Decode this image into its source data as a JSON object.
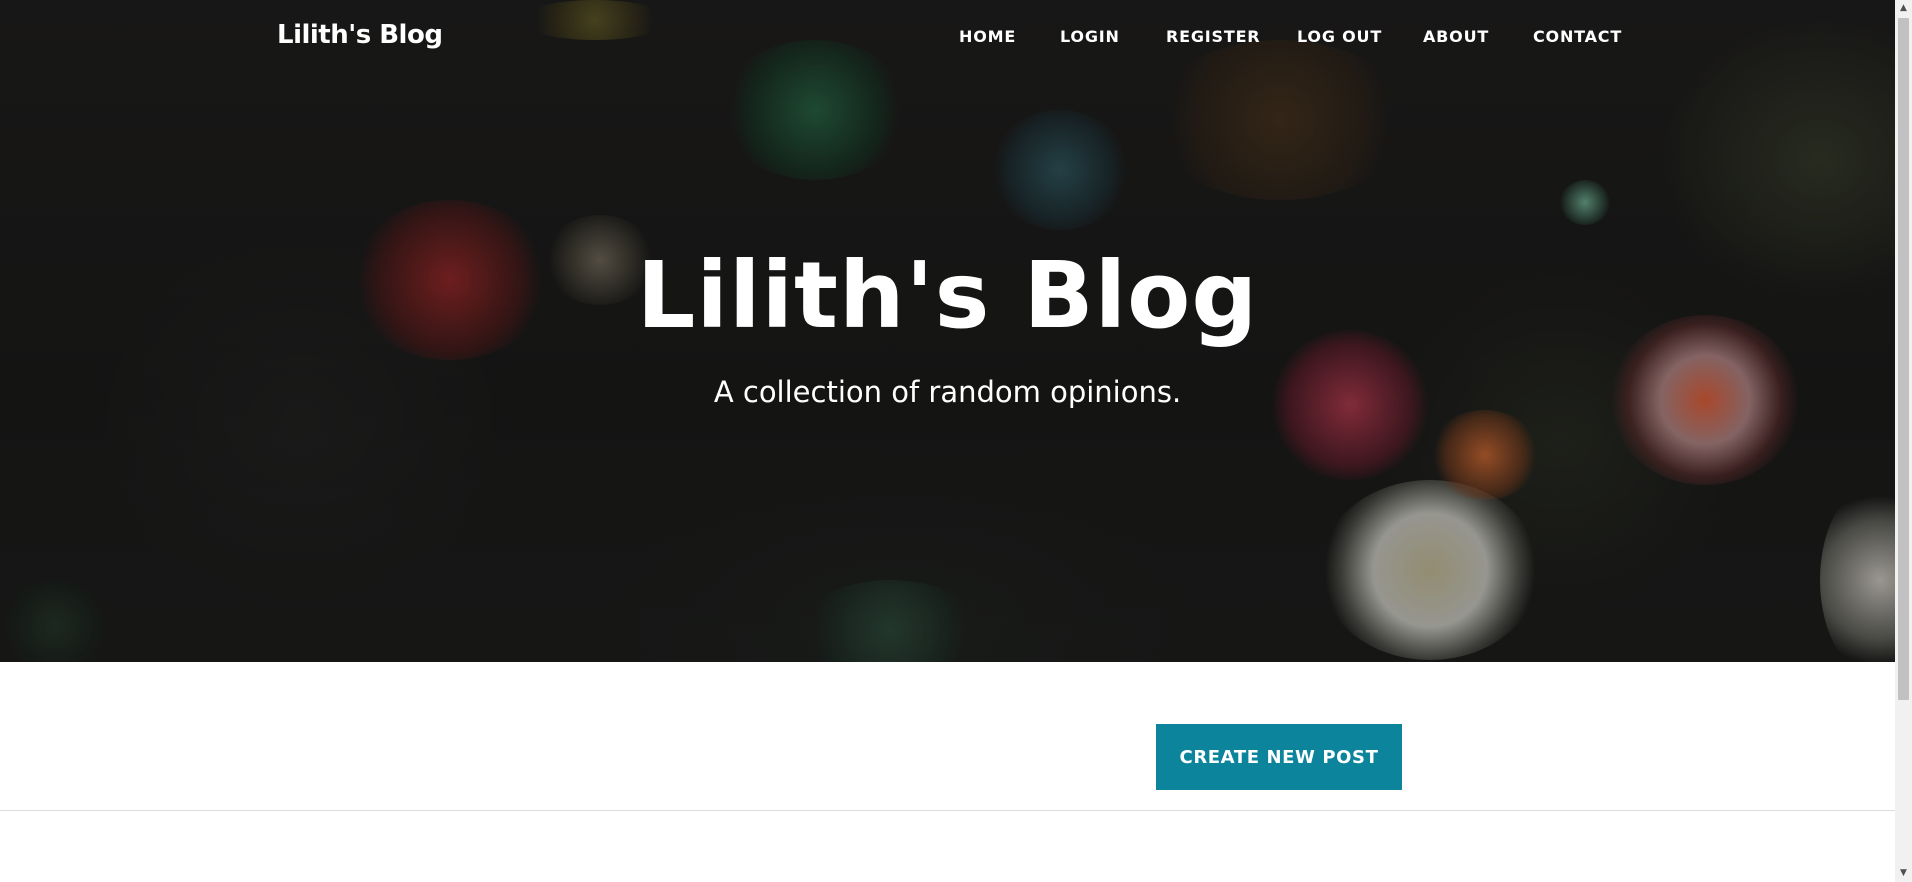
{
  "site": {
    "brand": "Lilith's Blog"
  },
  "nav": {
    "items": [
      {
        "label": "HOME"
      },
      {
        "label": "LOGIN"
      },
      {
        "label": "REGISTER"
      },
      {
        "label": "LOG OUT"
      },
      {
        "label": "ABOUT"
      },
      {
        "label": "CONTACT"
      }
    ]
  },
  "hero": {
    "title": "Lilith's Blog",
    "subtitle": "A collection of random opinions."
  },
  "main": {
    "create_button_label": "CREATE NEW POST"
  },
  "colors": {
    "accent": "#0b849c",
    "hero_background": "#1d1c1b",
    "text_on_hero": "#ffffff"
  },
  "icons": {
    "scroll_up": "scroll-up-arrow-icon",
    "scroll_down": "scroll-down-arrow-icon"
  }
}
